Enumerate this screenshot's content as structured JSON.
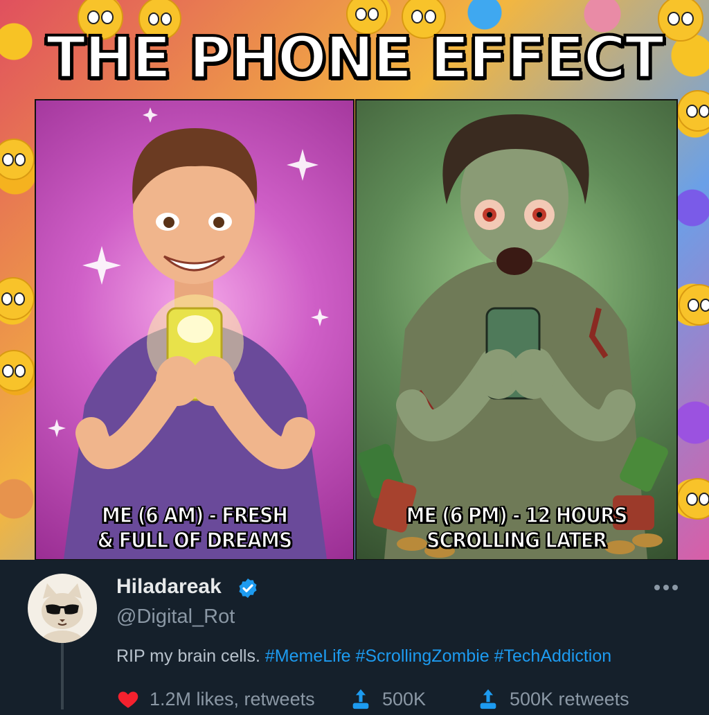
{
  "meme": {
    "title": "THE PHONE EFFECT",
    "left_panel": {
      "caption_line1": "ME (6 AM) - FRESH",
      "caption_line2": "& FULL OF DREAMS"
    },
    "right_panel": {
      "caption_line1": "ME (6 PM) - 12 HOURS",
      "caption_line2": "SCROLLING LATER"
    }
  },
  "tweet": {
    "display_name": "Hiladareak",
    "handle": "@Digital_Rot",
    "text_plain": "RIP my brain cells.",
    "hashtags": [
      "#MemeLife",
      "#ScrollingZombie",
      "#TechAddiction"
    ],
    "actions": [
      {
        "icon": "heart-icon",
        "label": "1.2M likes, retweets"
      },
      {
        "icon": "share-icon",
        "label": "500K"
      },
      {
        "icon": "retweet-icon",
        "label": "500K retweets"
      }
    ]
  },
  "colors": {
    "background": "#15202b",
    "accent": "#1d9bf0",
    "heart": "#f4212e",
    "text_primary": "#e7e9ea",
    "text_secondary": "#8b98a5"
  }
}
